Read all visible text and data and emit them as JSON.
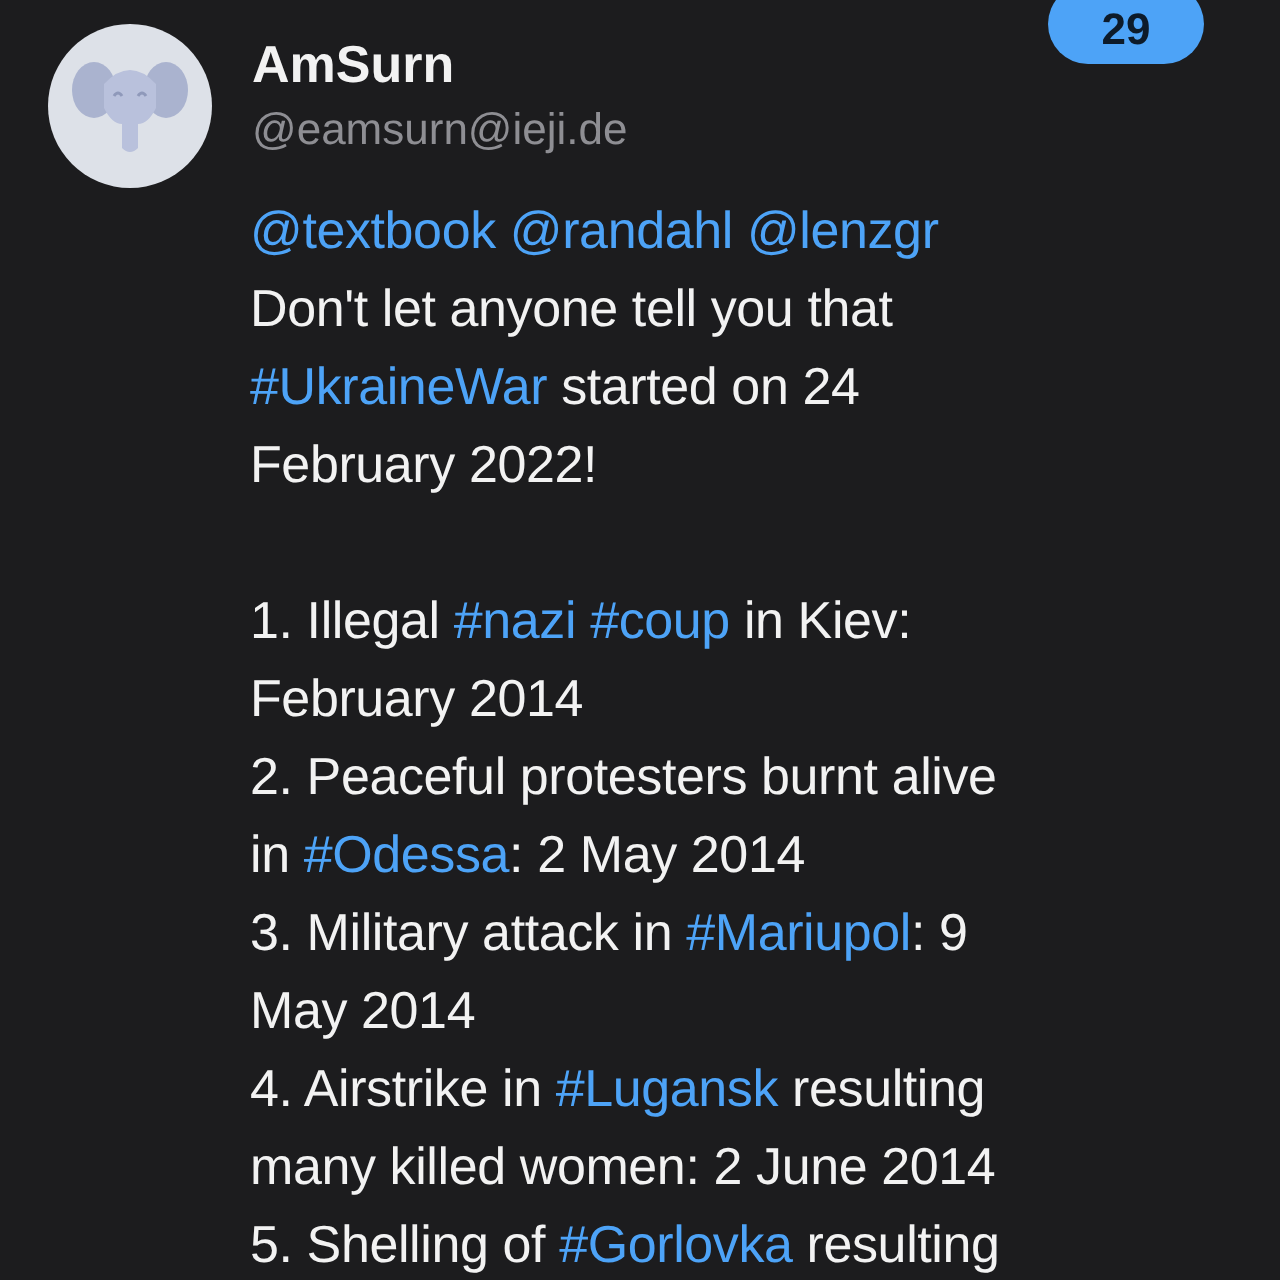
{
  "badge": {
    "count": "29"
  },
  "author": {
    "name": "AmSurn",
    "handle": "@eamsurn@ieji.de"
  },
  "post": {
    "paragraphs": [
      [
        [
          {
            "kind": "mention",
            "text": "@textbook "
          },
          {
            "kind": "mention",
            "text": "@randahl "
          },
          {
            "kind": "mention",
            "text": "@lenzgr"
          }
        ],
        [
          {
            "kind": "text",
            "text": "Don't let anyone tell you that"
          }
        ],
        [
          {
            "kind": "hashtag",
            "text": "#UkraineWar"
          },
          {
            "kind": "text",
            "text": " started on 24"
          }
        ],
        [
          {
            "kind": "text",
            "text": "February 2022!"
          }
        ]
      ],
      [
        [
          {
            "kind": "text",
            "text": "1. Illegal "
          },
          {
            "kind": "hashtag",
            "text": "#nazi"
          },
          {
            "kind": "hashtag",
            "text": " #coup"
          },
          {
            "kind": "text",
            "text": " in Kiev:"
          }
        ],
        [
          {
            "kind": "text",
            "text": "February 2014"
          }
        ],
        [
          {
            "kind": "text",
            "text": "2. Peaceful protesters burnt alive"
          }
        ],
        [
          {
            "kind": "text",
            "text": "in "
          },
          {
            "kind": "hashtag",
            "text": "#Odessa"
          },
          {
            "kind": "text",
            "text": ": 2 May 2014"
          }
        ],
        [
          {
            "kind": "text",
            "text": "3. Military attack in "
          },
          {
            "kind": "hashtag",
            "text": "#Mariupol"
          },
          {
            "kind": "text",
            "text": ": 9"
          }
        ],
        [
          {
            "kind": "text",
            "text": "May 2014"
          }
        ],
        [
          {
            "kind": "text",
            "text": "4. Airstrike in "
          },
          {
            "kind": "hashtag",
            "text": "#Lugansk"
          },
          {
            "kind": "text",
            "text": " resulting"
          }
        ],
        [
          {
            "kind": "text",
            "text": "many killed women: 2 June 2014"
          }
        ],
        [
          {
            "kind": "text",
            "text": "5. Shelling of "
          },
          {
            "kind": "hashtag",
            "text": "#Gorlovka"
          },
          {
            "kind": "text",
            "text": " resulting"
          }
        ]
      ]
    ]
  }
}
